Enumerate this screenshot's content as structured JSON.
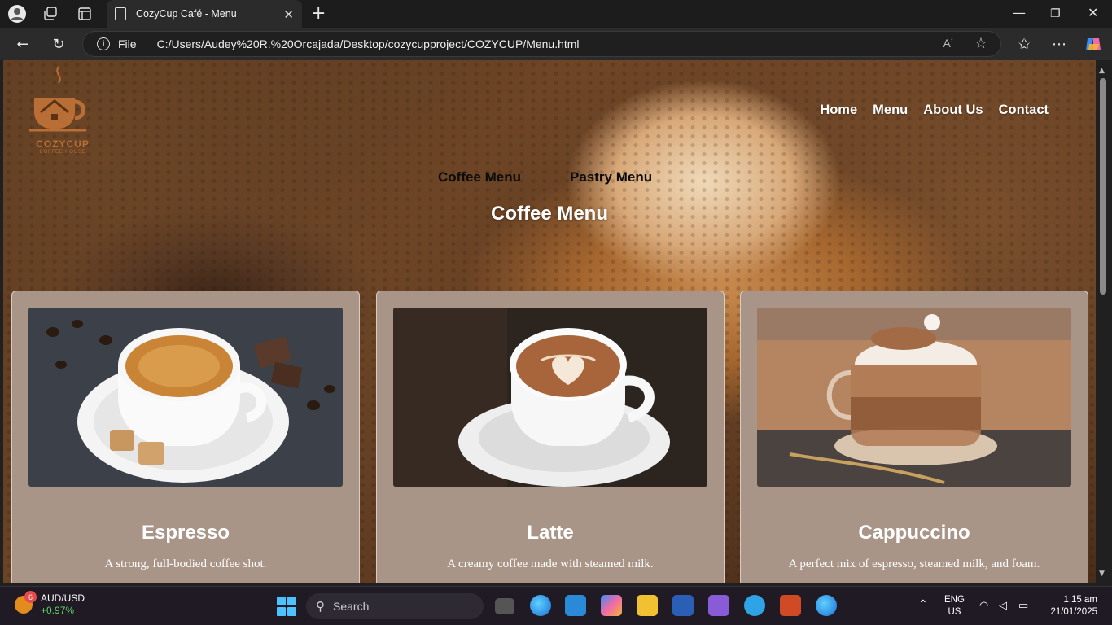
{
  "browser": {
    "tab_title": "CozyCup Café - Menu",
    "address_scheme": "File",
    "address_url": "C:/Users/Audey%20R.%20Orcajada/Desktop/cozycupproject/COZYCUP/Menu.html"
  },
  "site": {
    "logo_brand": "COZYCUP",
    "logo_sub": "COFFEE HOUSE",
    "nav": [
      "Home",
      "Menu",
      "About Us",
      "Contact"
    ],
    "menu_tabs": [
      "Coffee Menu",
      "Pastry Menu"
    ],
    "section_title": "Coffee Menu",
    "products": [
      {
        "name": "Espresso",
        "description": "A strong, full-bodied coffee shot."
      },
      {
        "name": "Latte",
        "description": "A creamy coffee made with steamed milk."
      },
      {
        "name": "Cappuccino",
        "description": "A perfect mix of espresso, steamed milk, and foam."
      }
    ]
  },
  "taskbar": {
    "widget_badge": "6",
    "widget_title": "AUD/USD",
    "widget_change": "+0.97%",
    "search_placeholder": "Search",
    "lang_top": "ENG",
    "lang_bottom": "US",
    "time": "1:15 am",
    "date": "21/01/2025"
  },
  "colors": {
    "card_bg": "#a89588",
    "logo_brand": "#b86e35",
    "accent_edge": "#4cc2ff"
  }
}
